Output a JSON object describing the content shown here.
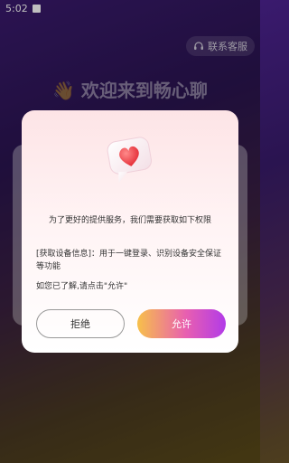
{
  "status_bar": {
    "time": "5:02"
  },
  "support": {
    "label": "联系客服",
    "icon": "headset-icon"
  },
  "welcome": {
    "text": "👋 欢迎来到畅心聊"
  },
  "dialog": {
    "icon": "heart-bubble-icon",
    "intro": "为了更好的提供服务，我们需要获取如下权限",
    "detail": "[获取设备信息]：用于一键登录、识别设备安全保证等功能",
    "confirm": "如您已了解,请点击\"允许\"",
    "reject_label": "拒绝",
    "allow_label": "允许"
  },
  "colors": {
    "accent_start": "#f7c04a",
    "accent_mid": "#e85fb0",
    "accent_end": "#b23be8"
  }
}
